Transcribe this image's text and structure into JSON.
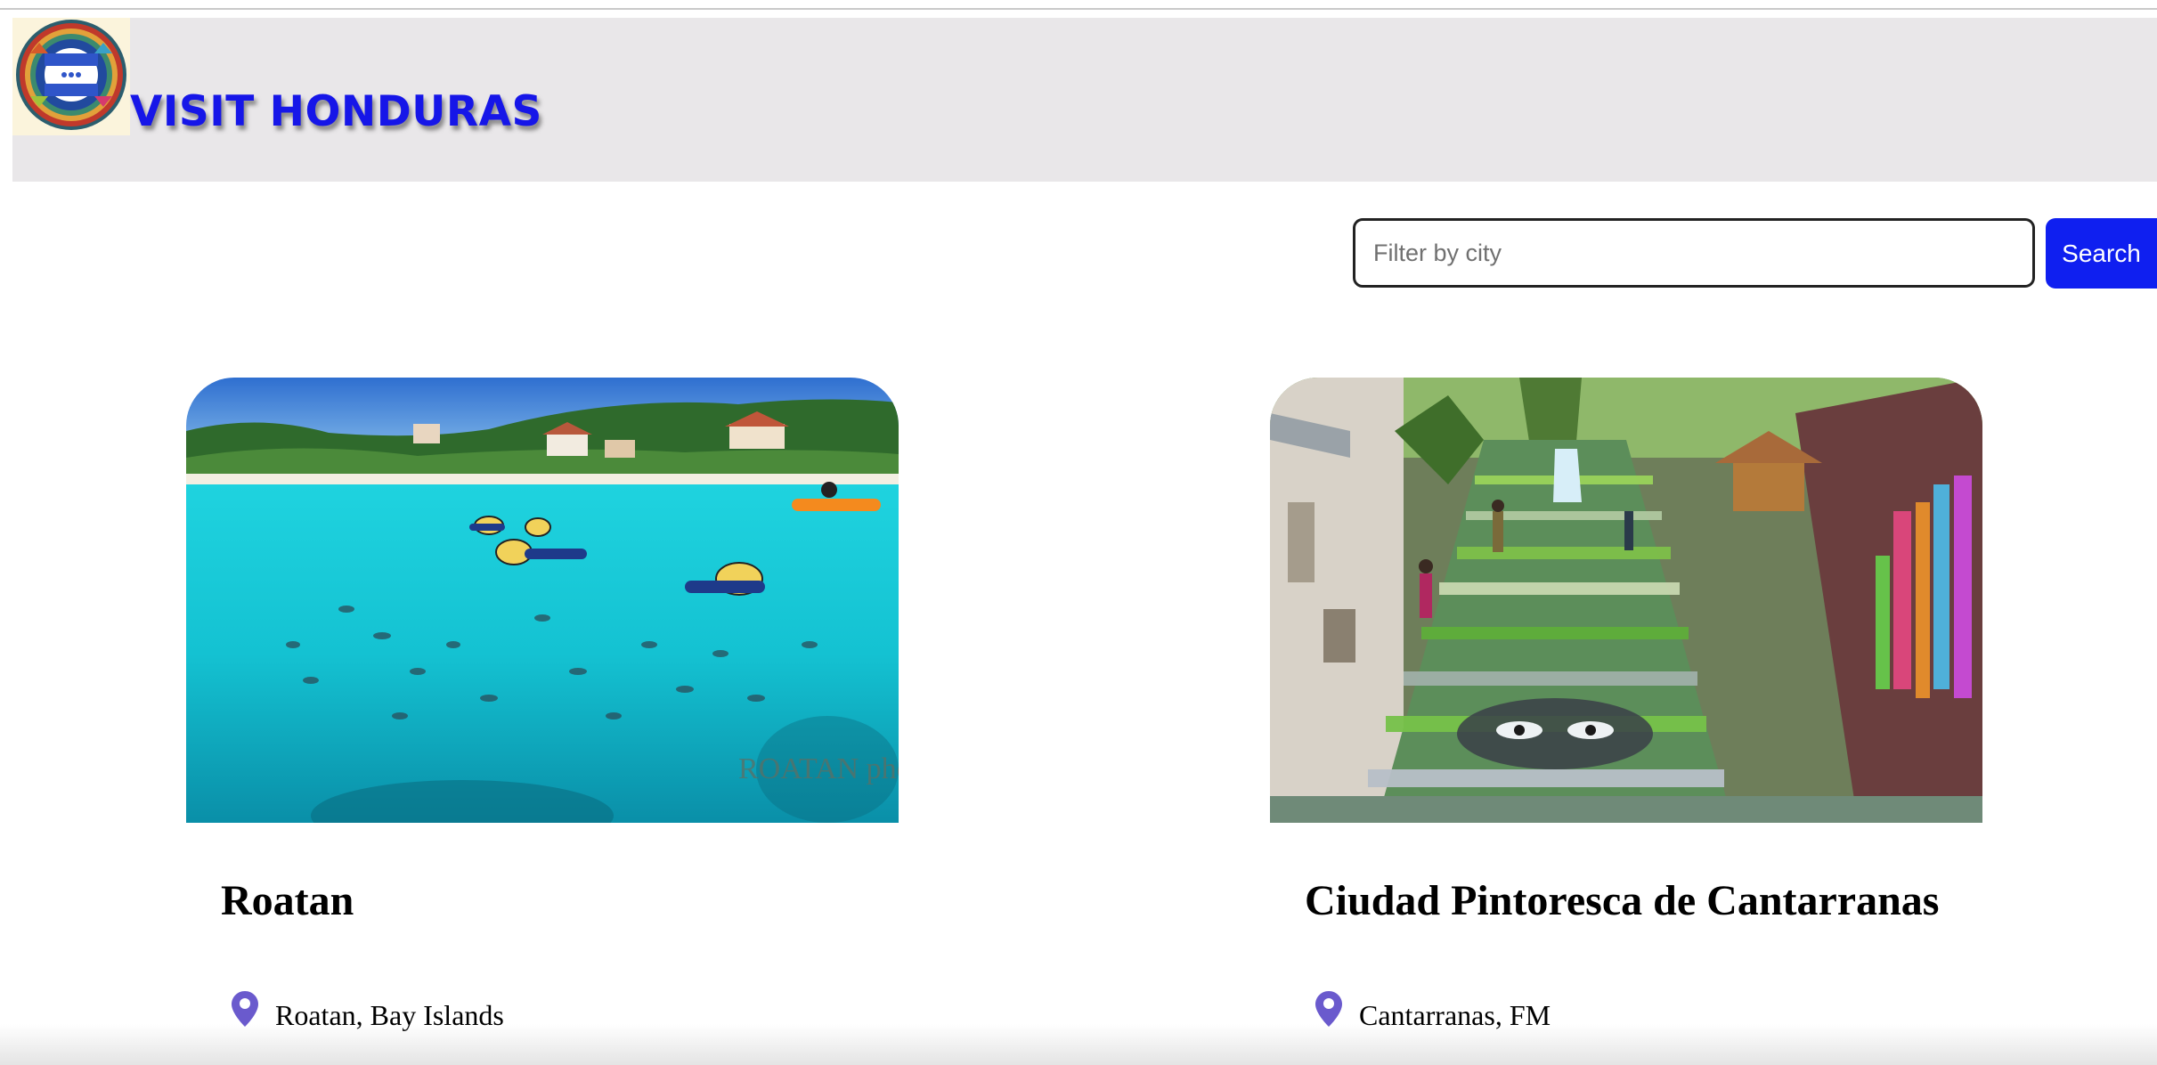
{
  "header": {
    "title": "VISIT HONDURAS",
    "logo_icon": "honduras-flag-seal-icon",
    "background": "#e9e7e9",
    "title_color": "#1616e8"
  },
  "search": {
    "placeholder": "Filter by city",
    "value": "",
    "button_label": "Search",
    "button_color": "#0f1ff0"
  },
  "cards": [
    {
      "title": "Roatan",
      "location": "Roatan, Bay Islands",
      "image": "snorkelers-turquoise-bay-photo",
      "image_watermark": "ROATAN photography"
    },
    {
      "title": "Ciudad Pintoresca de Cantarranas",
      "location": "Cantarranas, FM",
      "image": "painted-staircase-street-photo"
    }
  ],
  "icons": {
    "location": "map-pin-icon",
    "pin_color": "#6a5acd"
  }
}
